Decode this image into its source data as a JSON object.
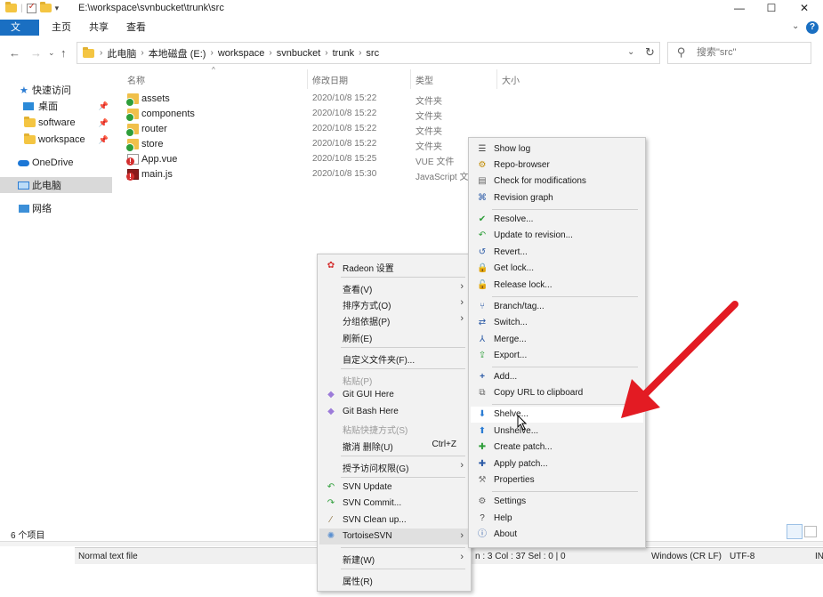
{
  "window": {
    "title": "E:\\workspace\\svnbucket\\trunk\\src",
    "minimize": "—",
    "maximize": "☐",
    "close": "✕"
  },
  "ribbon": {
    "tabs": [
      "文件",
      "主页",
      "共享",
      "查看"
    ],
    "help": "?",
    "expand": "⌄"
  },
  "address": {
    "crumbs": [
      "此电脑",
      "本地磁盘 (E:)",
      "workspace",
      "svnbucket",
      "trunk",
      "src"
    ],
    "dropdown": "⌄",
    "refresh": "↻"
  },
  "search": {
    "placeholder": "搜索\"src\""
  },
  "sidebar": {
    "items": [
      {
        "label": "快速访问"
      },
      {
        "label": "桌面"
      },
      {
        "label": "software"
      },
      {
        "label": "workspace"
      },
      {
        "label": "OneDrive"
      },
      {
        "label": "此电脑"
      },
      {
        "label": "网络"
      }
    ]
  },
  "columns": {
    "name": "名称",
    "date": "修改日期",
    "type": "类型",
    "size": "大小"
  },
  "files": [
    {
      "name": "assets",
      "date": "2020/10/8 15:22",
      "type": "文件夹"
    },
    {
      "name": "components",
      "date": "2020/10/8 15:22",
      "type": "文件夹"
    },
    {
      "name": "router",
      "date": "2020/10/8 15:22",
      "type": "文件夹"
    },
    {
      "name": "store",
      "date": "2020/10/8 15:22",
      "type": "文件夹"
    },
    {
      "name": "App.vue",
      "date": "2020/10/8 15:25",
      "type": "VUE 文件"
    },
    {
      "name": "main.js",
      "date": "2020/10/8 15:30",
      "type": "JavaScript 文"
    }
  ],
  "status": {
    "count": "6 个项目",
    "editor": {
      "mode": "Normal text file",
      "pos": "n : 3    Col : 37    Sel : 0 | 0",
      "eol": "Windows (CR LF)",
      "enc": "UTF-8",
      "ins": "IN"
    }
  },
  "context_menu": {
    "items": [
      {
        "label": "Radeon 设置"
      },
      {
        "label": "查看(V)"
      },
      {
        "label": "排序方式(O)"
      },
      {
        "label": "分组依据(P)"
      },
      {
        "label": "刷新(E)"
      },
      {
        "label": "自定义文件夹(F)..."
      },
      {
        "label": "粘贴(P)"
      },
      {
        "label": "Git GUI Here"
      },
      {
        "label": "Git Bash Here"
      },
      {
        "label": "粘贴快捷方式(S)"
      },
      {
        "label": "撤消 删除(U)",
        "shortcut": "Ctrl+Z"
      },
      {
        "label": "授予访问权限(G)"
      },
      {
        "label": "SVN Update"
      },
      {
        "label": "SVN Commit..."
      },
      {
        "label": "SVN Clean up..."
      },
      {
        "label": "TortoiseSVN"
      },
      {
        "label": "新建(W)"
      },
      {
        "label": "属性(R)"
      }
    ]
  },
  "svn_menu": {
    "items": [
      {
        "label": "Show log"
      },
      {
        "label": "Repo-browser"
      },
      {
        "label": "Check for modifications"
      },
      {
        "label": "Revision graph"
      },
      {
        "label": "Resolve..."
      },
      {
        "label": "Update to revision..."
      },
      {
        "label": "Revert..."
      },
      {
        "label": "Get lock..."
      },
      {
        "label": "Release lock..."
      },
      {
        "label": "Branch/tag..."
      },
      {
        "label": "Switch..."
      },
      {
        "label": "Merge..."
      },
      {
        "label": "Export..."
      },
      {
        "label": "Add..."
      },
      {
        "label": "Copy URL to clipboard"
      },
      {
        "label": "Shelve..."
      },
      {
        "label": "Unshelve..."
      },
      {
        "label": "Create patch..."
      },
      {
        "label": "Apply patch..."
      },
      {
        "label": "Properties"
      },
      {
        "label": "Settings"
      },
      {
        "label": "Help"
      },
      {
        "label": "About"
      }
    ]
  },
  "colors": {
    "accent": "#1a6fc2",
    "arrow": "#e31b23",
    "svn_green": "#2e9e3a",
    "menu_bg": "#f2f2f2"
  }
}
